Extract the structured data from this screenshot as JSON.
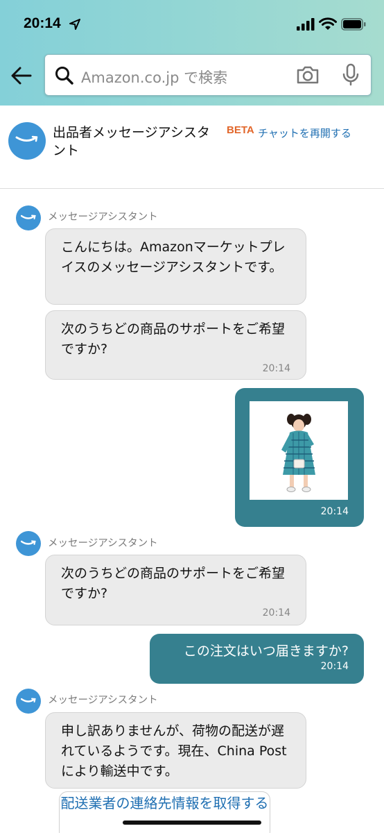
{
  "status_bar": {
    "time": "20:14"
  },
  "search": {
    "placeholder": "Amazon.co.jp で検索"
  },
  "header": {
    "title": "出品者メッセージアシスタント",
    "beta": "BETA",
    "reopen_chat": "チャットを再開する"
  },
  "messages": [
    {
      "sender": "メッセージアシスタント",
      "text": "こんにちは。Amazonマーケットプレイスのメッセージアシスタントです。"
    },
    {
      "text": "次のうちどの商品のサポートをご希望ですか?",
      "time": "20:14"
    },
    {
      "time": "20:14"
    },
    {
      "sender": "メッセージアシスタント",
      "text": "次のうちどの商品のサポートをご希望ですか?",
      "time": "20:14"
    },
    {
      "text": "この注文はいつ届きますか?",
      "time": "20:14"
    },
    {
      "sender": "メッセージアシスタント",
      "text": "申し訳ありませんが、荷物の配送が遅れているようです。現在、China Postにより輸送中です。"
    }
  ],
  "carrier_link": "配送業者の連絡先情報を取得する",
  "colors": {
    "accent": "#36808f",
    "logo": "#3e95d6",
    "beta": "#e2672b",
    "link": "#1f6fb2",
    "bubble_in": "#ebebeb"
  }
}
